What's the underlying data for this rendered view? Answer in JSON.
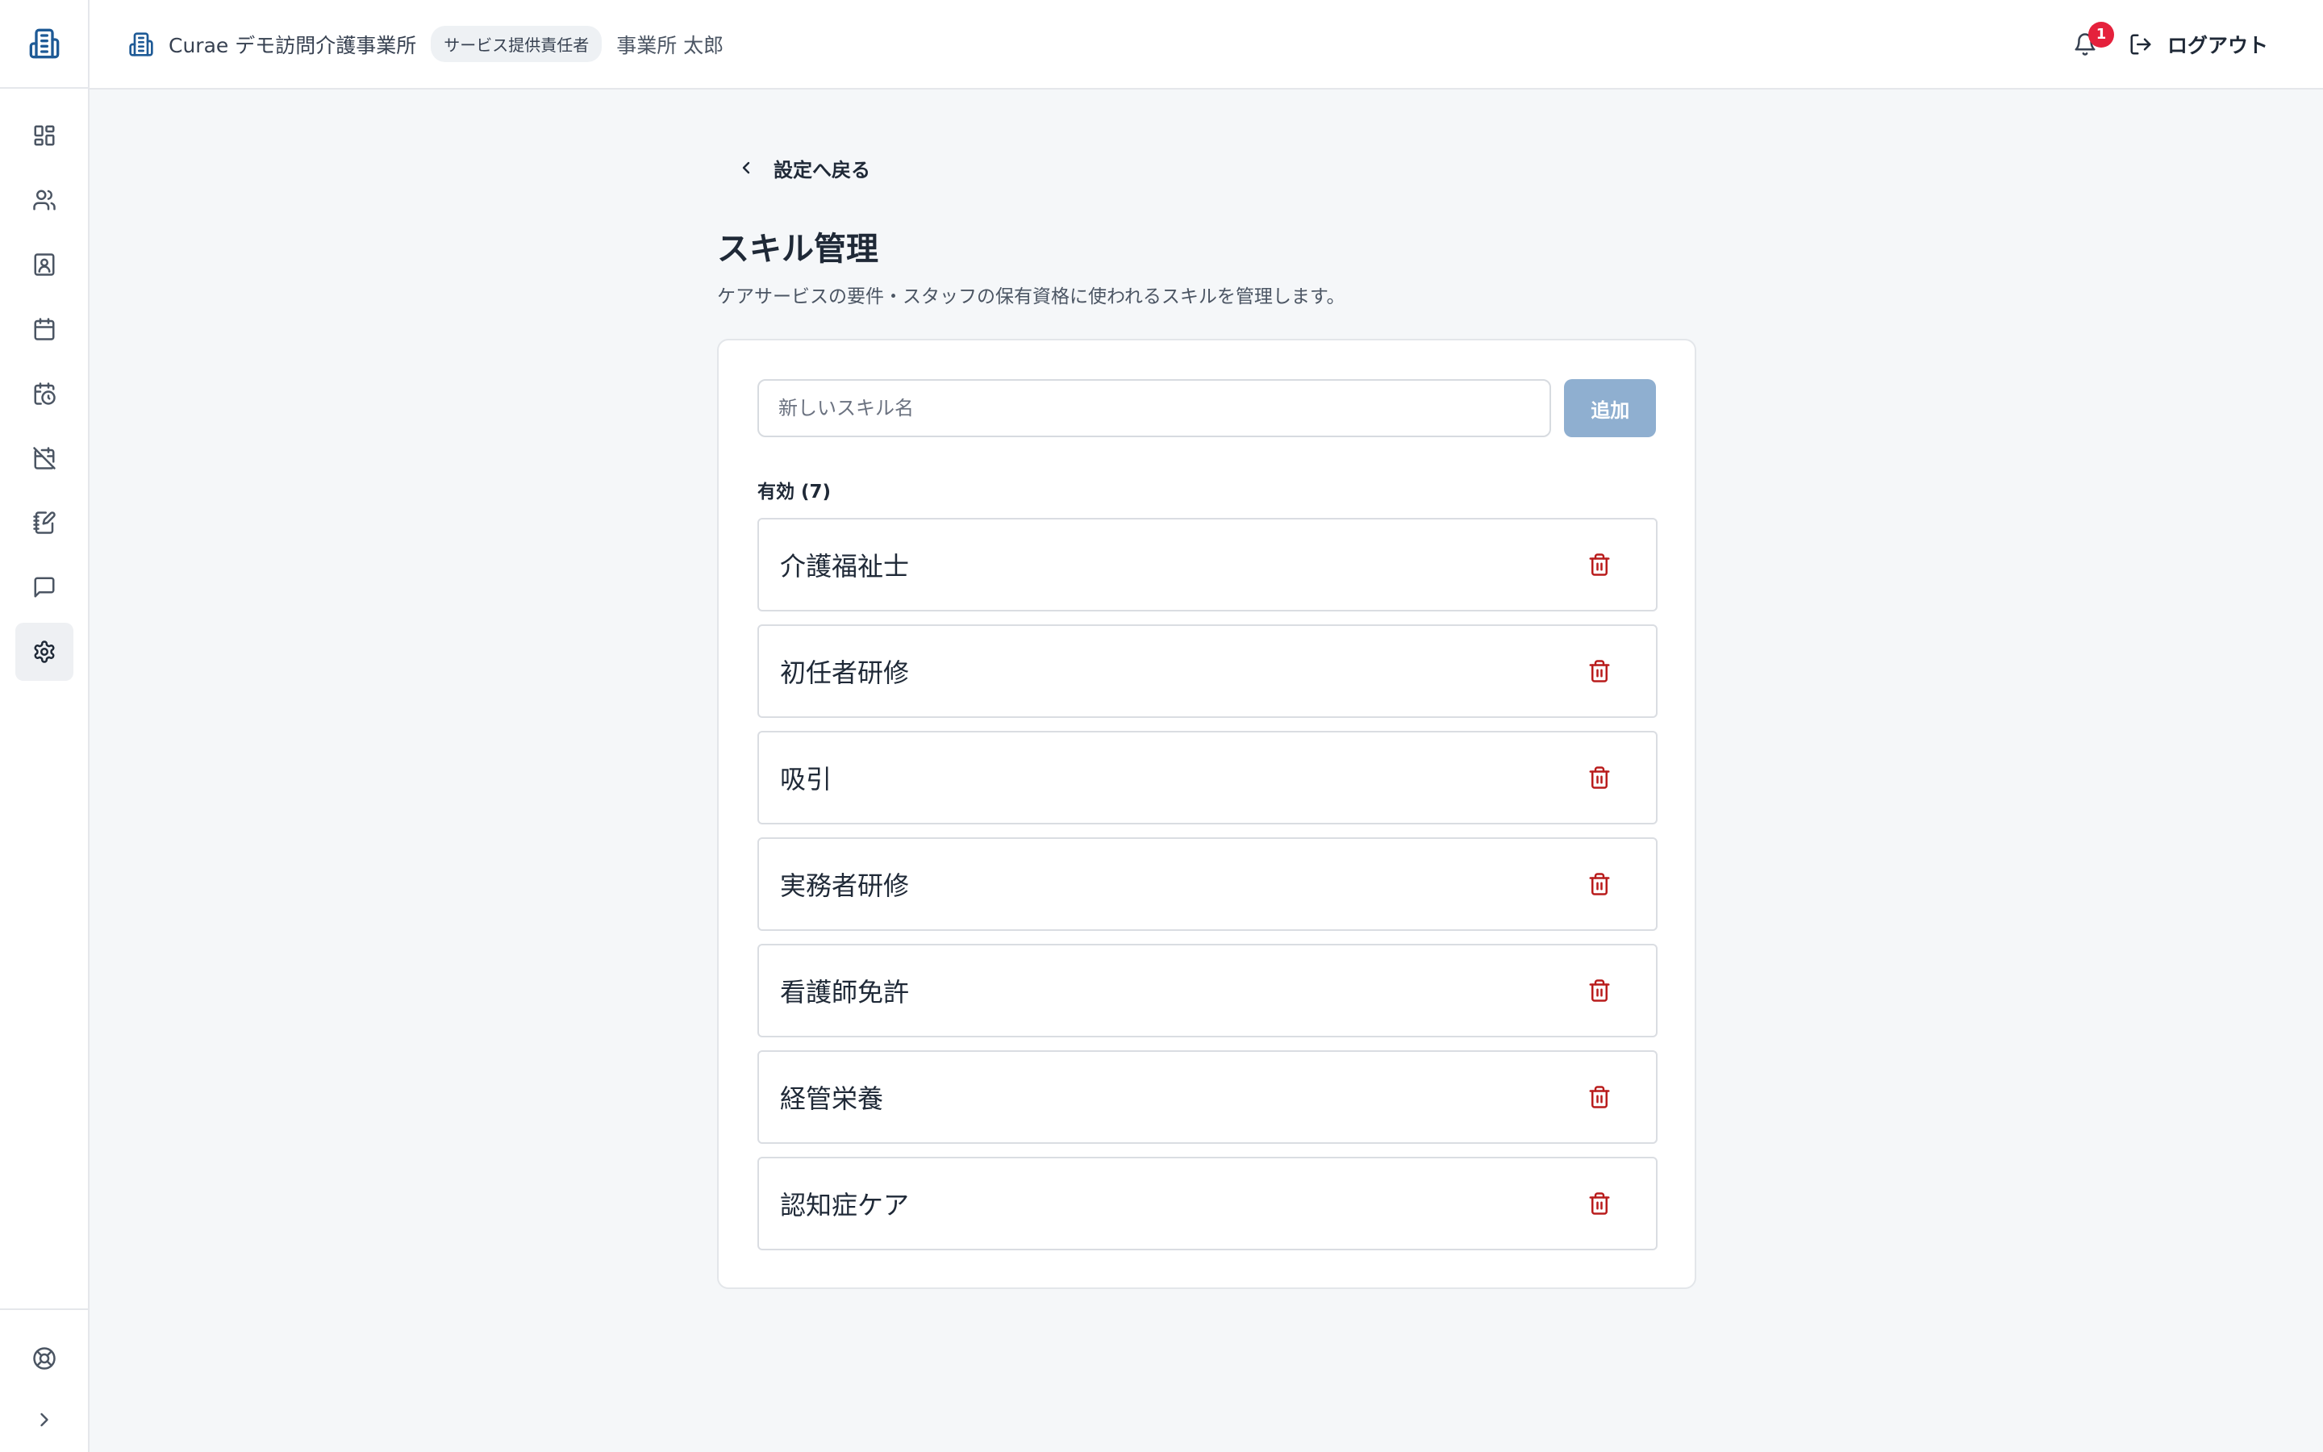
{
  "sidebar": {
    "logo_icon": "building-icon",
    "items": [
      {
        "icon": "dashboard-icon",
        "active": false
      },
      {
        "icon": "users-icon",
        "active": false
      },
      {
        "icon": "contact-icon",
        "active": false
      },
      {
        "icon": "calendar-icon",
        "active": false
      },
      {
        "icon": "calendar-clock-icon",
        "active": false
      },
      {
        "icon": "calendar-off-icon",
        "active": false
      },
      {
        "icon": "notebook-pen-icon",
        "active": false
      },
      {
        "icon": "message-icon",
        "active": false
      },
      {
        "icon": "gear-icon",
        "active": true
      }
    ],
    "bottom_items": [
      {
        "icon": "lifebuoy-icon"
      },
      {
        "icon": "chevron-right-icon"
      }
    ]
  },
  "header": {
    "org_name": "Curae デモ訪問介護事業所",
    "role_badge": "サービス提供責任者",
    "user_name": "事業所 太郎",
    "notification_count": "1",
    "logout_label": "ログアウト"
  },
  "page": {
    "back_label": "設定へ戻る",
    "title": "スキル管理",
    "description": "ケアサービスの要件・スタッフの保有資格に使われるスキルを管理します。"
  },
  "form": {
    "input_value": "",
    "input_placeholder": "新しいスキル名",
    "add_label": "追加"
  },
  "list": {
    "section_label": "有効 (7)",
    "skills": [
      {
        "name": "介護福祉士"
      },
      {
        "name": "初任者研修"
      },
      {
        "name": "吸引"
      },
      {
        "name": "実務者研修"
      },
      {
        "name": "看護師免許"
      },
      {
        "name": "経管栄養"
      },
      {
        "name": "認知症ケア"
      }
    ]
  },
  "colors": {
    "accent": "#1e5a96",
    "add_button": "#8fafd0",
    "delete": "#b91c1c",
    "badge": "#e5213c",
    "background": "#f5f7f9"
  }
}
